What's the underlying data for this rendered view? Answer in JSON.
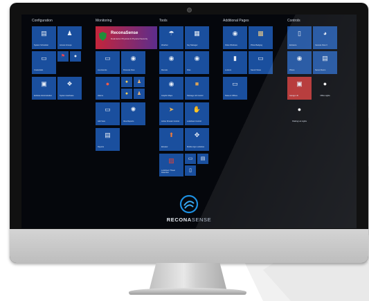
{
  "columns": {
    "configuration": "Configuration",
    "monitoring": "Monitoring",
    "tools": "Tools",
    "additional": "Additional Pages",
    "controls": "Controls"
  },
  "tiles": {
    "system_scheduler": "System Scheduler",
    "access_groups": "Access Groups",
    "credentials": "Credentials",
    "eximation_administration": "ExiNote Administration",
    "system_hardware": "System Hardware",
    "live_events": "Live Events",
    "personal_view": "Personal View",
    "alarms": "Alarms",
    "area_view": "Add View",
    "view_reports": "View Reports",
    "reports": "Reports",
    "weather": "Weather",
    "key_manager": "Key Manager",
    "remote": "Remote",
    "files": "Files",
    "graphic_maps": "Graphic Maps",
    "package_lift_control": "Package Lift Control",
    "active_shooter": "Active Shooter Control",
    "lockdown_control": "Lockdown Control",
    "elevator": "Elevator",
    "mobile_app": "Mobile App Lockdown",
    "lockdown_threat": "Lockdown Threat Detection",
    "video_windows": "Video Windows",
    "photo_badging": "Photo Badging",
    "lockers": "Lockers",
    "saved_views": "Saved Views",
    "notes_offices": "Notes & Offices",
    "entrance": "Entrance",
    "camera_view": "Camera View 3",
    "phone": "Phone",
    "server_room": "Server Room",
    "garage_lift": "Garage Lift",
    "office_lights": "Office Lights",
    "parking_lot": "Parking Lot Lights"
  },
  "hero": {
    "title": "ReconaSense",
    "subtitle": "Dual-factor Physical & Physical Security"
  },
  "brand": {
    "bold": "RECONA",
    "light": "SENSE"
  },
  "colors": {
    "tile_blue": "#1a4f9e",
    "tile_red": "#b22d2d",
    "screen_bg": "#05070c"
  }
}
